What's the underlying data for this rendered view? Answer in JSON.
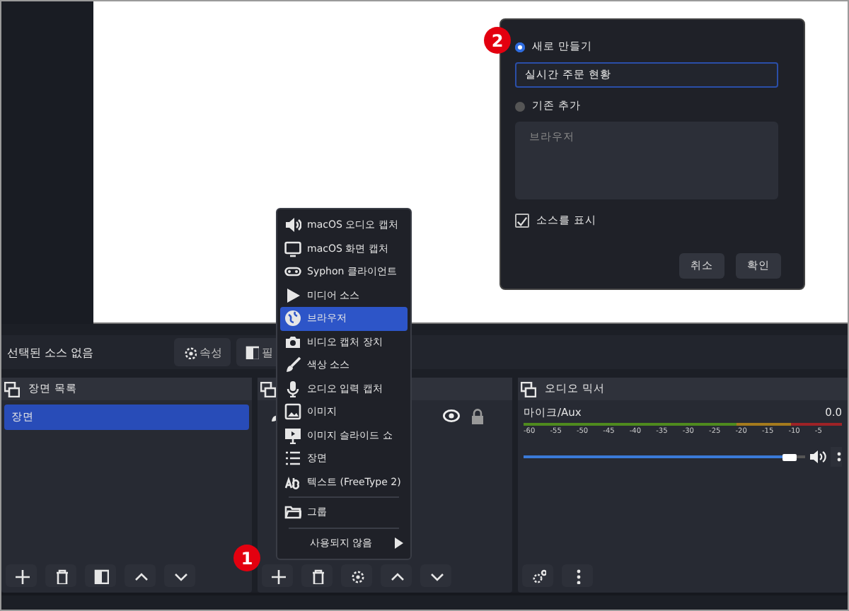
{
  "toolbar": {
    "status": "선택된 소스 없음",
    "buttons": [
      {
        "label": "속성"
      },
      {
        "label": "필"
      }
    ]
  },
  "scenes": {
    "title": "장면 목록",
    "items": [
      {
        "label": "장면",
        "selected": true
      }
    ]
  },
  "sources": {
    "rows": [
      {
        "visible": true,
        "locked": true
      }
    ]
  },
  "mixer": {
    "title": "오디오 믹서",
    "channels": [
      {
        "name": "마이크/Aux",
        "reading": "0.0",
        "level": 0.97,
        "ticks": [
          "-60",
          "-55",
          "-50",
          "-45",
          "-40",
          "-35",
          "-30",
          "-25",
          "-20",
          "-15",
          "-10",
          "-5"
        ]
      }
    ]
  },
  "menu": {
    "items": [
      {
        "kind": "item",
        "label": "macOS 오디오 캡처",
        "selected": false
      },
      {
        "kind": "item",
        "label": "macOS 화면 캡처",
        "selected": false
      },
      {
        "kind": "item",
        "label": "Syphon 클라이언트",
        "selected": false
      },
      {
        "kind": "item",
        "label": "미디어 소스",
        "selected": false
      },
      {
        "kind": "item",
        "label": "브라우저",
        "selected": true
      },
      {
        "kind": "item",
        "label": "비디오 캡처 장치",
        "selected": false
      },
      {
        "kind": "item",
        "label": "색상 소스",
        "selected": false
      },
      {
        "kind": "item",
        "label": "오디오 입력 캡처",
        "selected": false
      },
      {
        "kind": "item",
        "label": "이미지",
        "selected": false
      },
      {
        "kind": "item",
        "label": "이미지 슬라이드 쇼",
        "selected": false
      },
      {
        "kind": "item",
        "label": "장면",
        "selected": false
      },
      {
        "kind": "item",
        "label": "텍스트 (FreeType 2)",
        "selected": false
      },
      {
        "kind": "separator"
      },
      {
        "kind": "item",
        "label": "그룹",
        "selected": false
      },
      {
        "kind": "separator"
      },
      {
        "kind": "submenu",
        "label": "사용되지 않음",
        "selected": false
      }
    ]
  },
  "dialog": {
    "options": [
      {
        "label": "새로 만들기",
        "selected": true
      },
      {
        "label": "기존 추가",
        "selected": false
      }
    ],
    "name_value": "실시간 주문 현황",
    "existing": [
      "브라우저"
    ],
    "show_source": {
      "label": "소스를 표시",
      "checked": true
    },
    "buttons": [
      "취소",
      "확인"
    ]
  },
  "badges": [
    {
      "label": "1"
    },
    {
      "label": "2"
    }
  ]
}
